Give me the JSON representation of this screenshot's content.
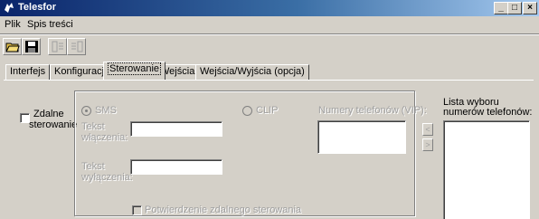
{
  "window": {
    "title": "Telesfor",
    "minimize": "_",
    "maximize": "□",
    "close": "×"
  },
  "menu": {
    "items": [
      {
        "label": "Plik"
      },
      {
        "label": "Spis treści"
      }
    ]
  },
  "toolbar": {
    "buttons": [
      {
        "icon": "open-folder-icon"
      },
      {
        "icon": "save-icon"
      },
      {
        "icon": "tile-left-icon"
      },
      {
        "icon": "tile-right-icon"
      }
    ]
  },
  "tabs": [
    {
      "label": "Interfejs"
    },
    {
      "label": "Konfiguracja"
    },
    {
      "label": "Sterowanie",
      "active": true
    },
    {
      "label": "Wejścia"
    },
    {
      "label": "Wejścia/Wyjścia (opcja)"
    }
  ],
  "sterowanie": {
    "remote_label_line1": "Zdalne",
    "remote_label_line2": "sterowanie",
    "sms_label": "SMS",
    "clip_label": "CLIP",
    "on_text_label_line1": "Tekst",
    "on_text_label_line2": "włączenia:",
    "on_text_value": "",
    "off_text_label_line1": "Tekst",
    "off_text_label_line2": "wyłączenia:",
    "off_text_value": "",
    "vip_label": "Numery telefonów (VIP):",
    "confirm_label": "Potwierdzenie zdalnego sterowania",
    "list_label_line1": "Lista wyboru",
    "list_label_line2": "numerów telefonów:",
    "arrow_left": "<",
    "arrow_right": ">"
  }
}
